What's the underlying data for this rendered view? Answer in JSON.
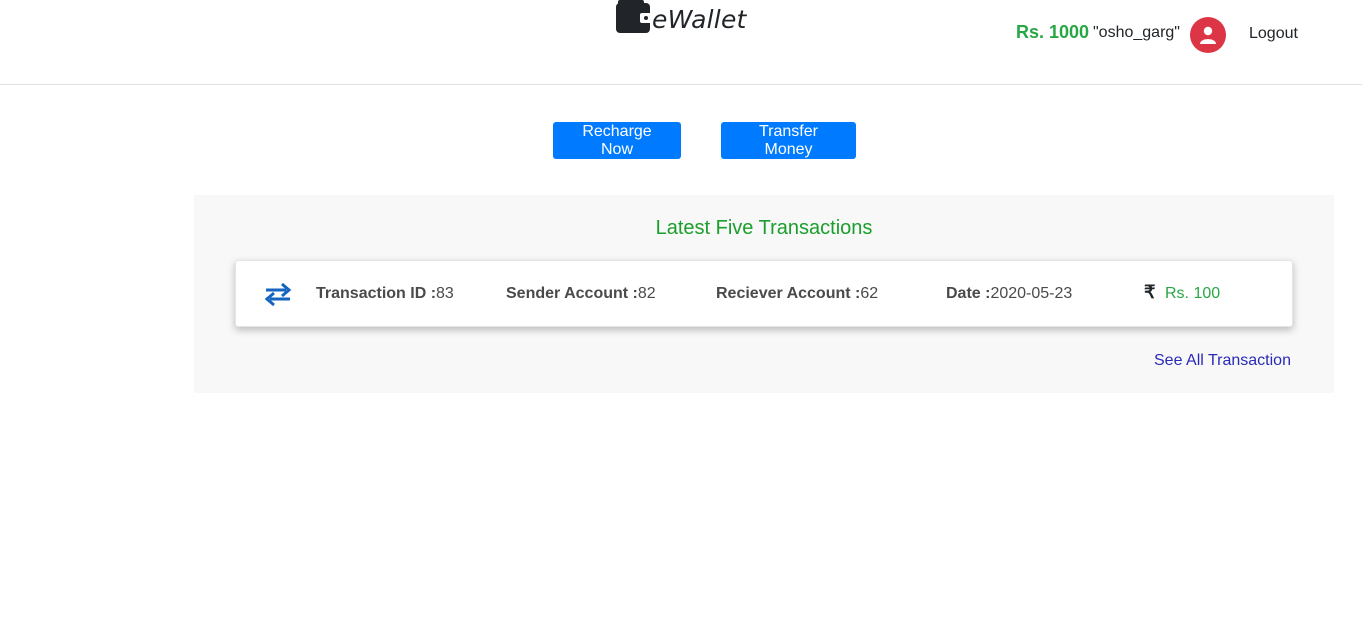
{
  "header": {
    "brand": "eWallet",
    "balance": "Rs. 1000",
    "username": "\"osho_garg\"",
    "logout_label": "Logout"
  },
  "actions": {
    "recharge_label": "Recharge Now",
    "transfer_label": "Transfer Money"
  },
  "transactions": {
    "title": "Latest Five Transactions",
    "items": [
      {
        "txid_label": "Transaction ID :",
        "txid": "83",
        "sender_label": "Sender Account :",
        "sender": "82",
        "receiver_label": "Reciever Account :",
        "receiver": "62",
        "date_label": "Date :",
        "date": "2020-05-23",
        "currency_symbol": "₹",
        "amount": "Rs. 100"
      }
    ],
    "see_all_label": "See All Transaction"
  },
  "colors": {
    "primary": "#007bff",
    "success": "#28a745",
    "avatar": "#dc3545",
    "link": "#2a2ab8"
  },
  "icons": {
    "brand": "wallet-icon",
    "avatar": "user-icon",
    "transaction": "swap-arrows-icon",
    "currency": "rupee-icon"
  }
}
